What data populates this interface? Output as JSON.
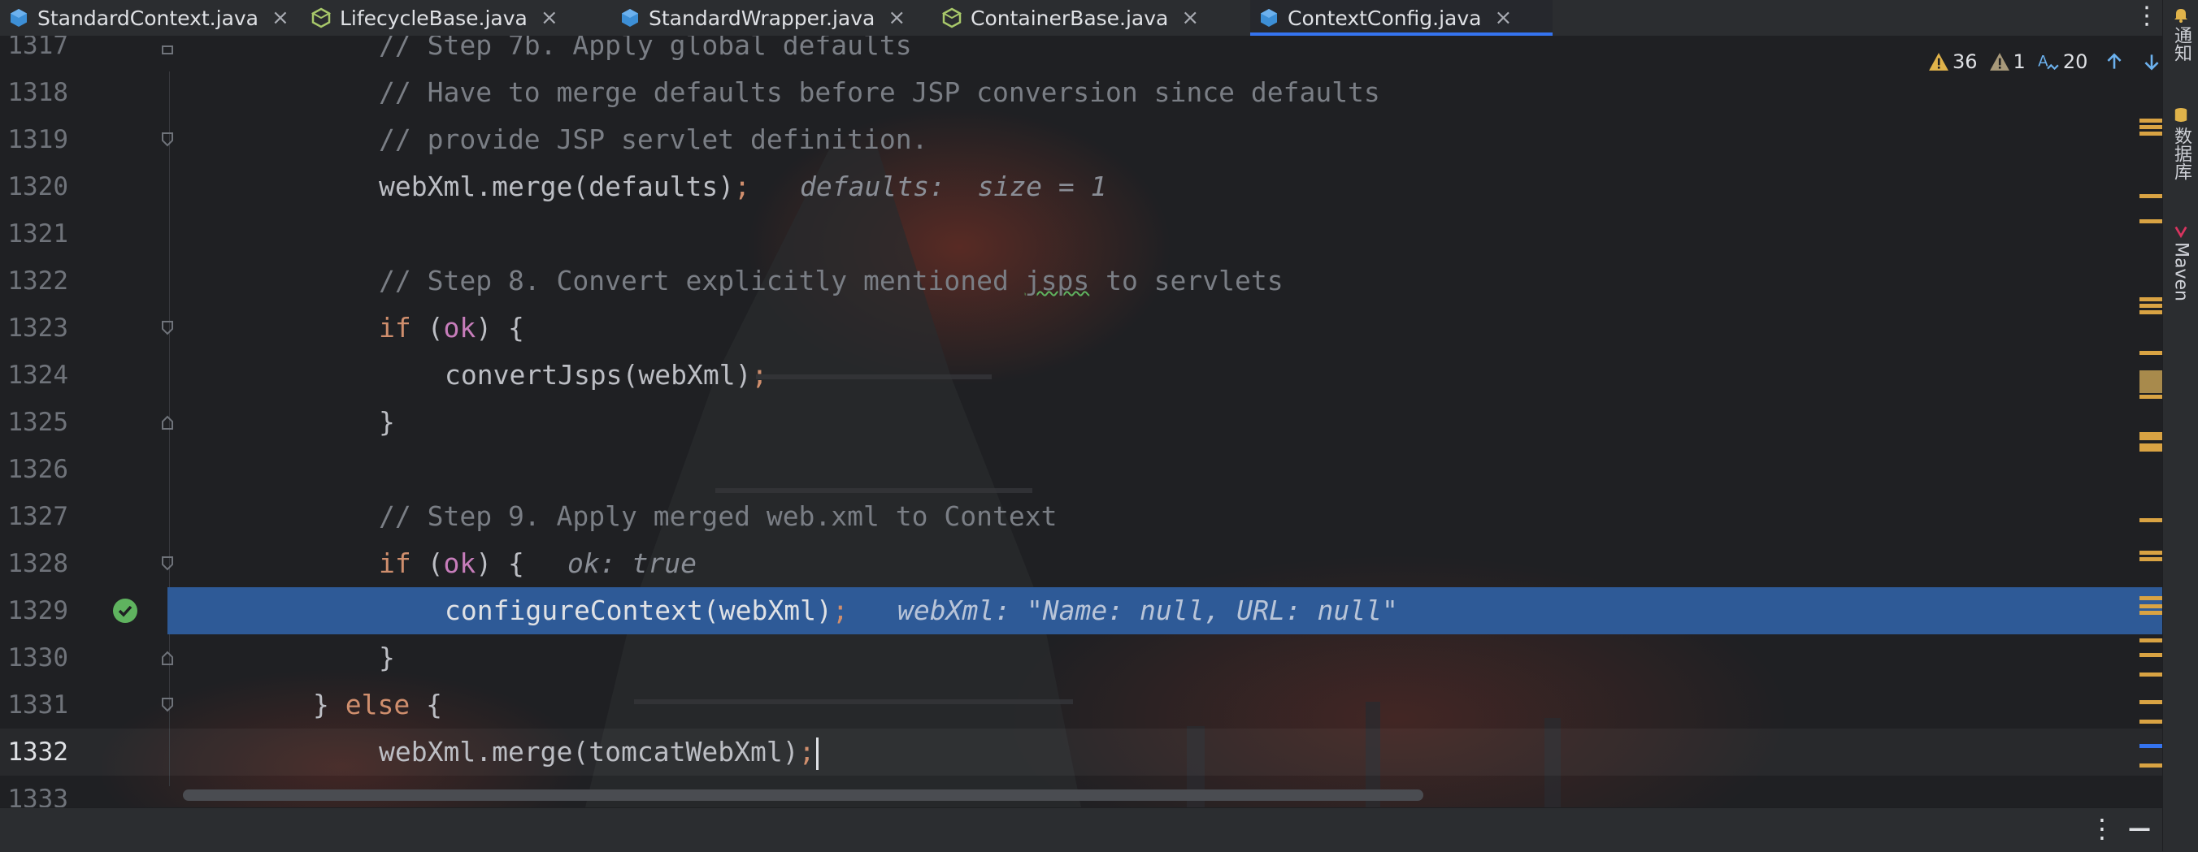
{
  "tabs": [
    {
      "label": "StandardContext.java",
      "icon": "java-class-icon",
      "active": false
    },
    {
      "label": "LifecycleBase.java",
      "icon": "java-abstract-class-icon",
      "active": false
    },
    {
      "label": "StandardWrapper.java",
      "icon": "java-class-icon",
      "active": false
    },
    {
      "label": "ContainerBase.java",
      "icon": "java-abstract-class-icon",
      "active": false
    },
    {
      "label": "ContextConfig.java",
      "icon": "java-class-icon",
      "active": true
    }
  ],
  "tab_close_glyph": "×",
  "tab_menu_glyph": "⋮",
  "inspections": {
    "warnings": "36",
    "weak_warnings": "1",
    "typos": "20"
  },
  "right_strip": {
    "notifications": "通知",
    "database": "数据库",
    "maven": "Maven"
  },
  "bottom": {
    "options_glyph": "⋮",
    "minimize_glyph": "—"
  },
  "lines": {
    "l1317": {
      "num": "1317",
      "comment": "// Step 7b. Apply global defaults"
    },
    "l1318": {
      "num": "1318",
      "comment": "// Have to merge defaults before JSP conversion since defaults"
    },
    "l1319": {
      "num": "1319",
      "comment": "// provide JSP servlet definition."
    },
    "l1320": {
      "num": "1320",
      "code": "webXml.merge(defaults)",
      "semi": ";",
      "hint": "defaults:  size = 1"
    },
    "l1321": {
      "num": "1321"
    },
    "l1322": {
      "num": "1322",
      "comment_a": "// Step 8. Convert explicitly mentioned ",
      "comment_typo": "jsps",
      "comment_b": " to servlets"
    },
    "l1323": {
      "num": "1323",
      "kw": "if",
      "open": " (",
      "var": "ok",
      "close": ") {"
    },
    "l1324": {
      "num": "1324",
      "code": "convertJsps(webXml)",
      "semi": ";"
    },
    "l1325": {
      "num": "1325",
      "code": "}"
    },
    "l1326": {
      "num": "1326"
    },
    "l1327": {
      "num": "1327",
      "comment": "// Step 9. Apply merged web.xml to Context"
    },
    "l1328": {
      "num": "1328",
      "kw": "if",
      "open": " (",
      "var": "ok",
      "close": ") {",
      "hint": "ok: true"
    },
    "l1329": {
      "num": "1329",
      "code": "configureContext(webXml)",
      "semi": ";",
      "hint": "webXml: \"Name: null, URL: null\""
    },
    "l1330": {
      "num": "1330",
      "code": "}"
    },
    "l1331": {
      "num": "1331",
      "brace": "} ",
      "kw": "else",
      "rest": " {"
    },
    "l1332": {
      "num": "1332",
      "code": "webXml.merge(tomcatWebXml)",
      "semi": ";"
    },
    "l1333": {
      "num": "1333"
    }
  },
  "colors": {
    "execution_line": "#2e5a97",
    "keyword": "#cf8e6d",
    "comment": "#7a7e85",
    "local_var": "#c77dbb",
    "active_tab_underline": "#3574f0",
    "breakpoint_check": "#5fb35f",
    "warning": "#e0b34a"
  }
}
